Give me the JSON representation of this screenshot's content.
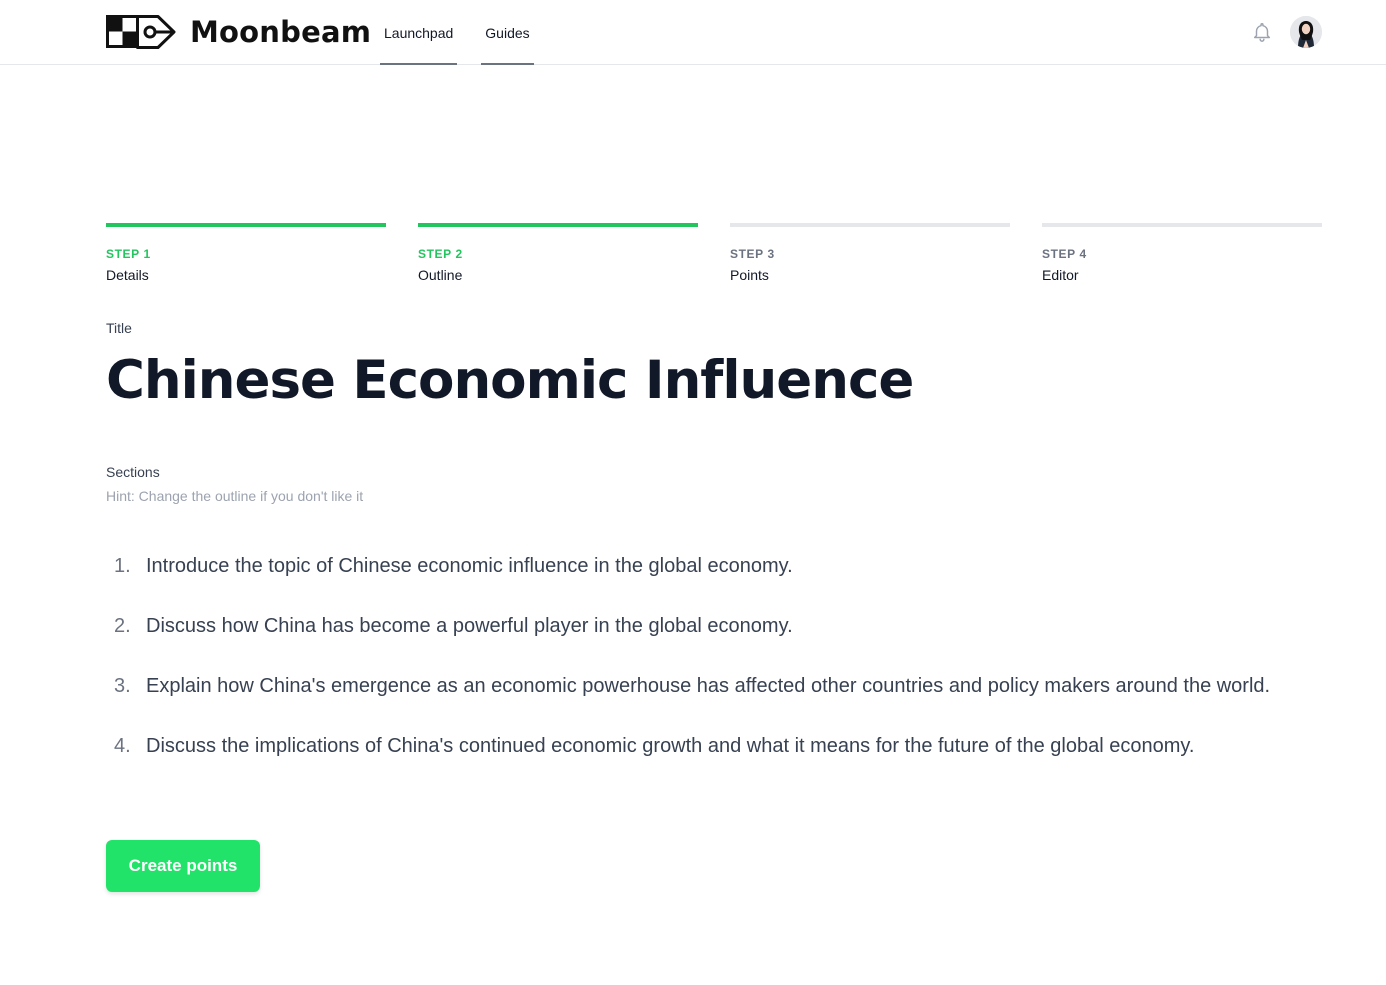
{
  "app": {
    "name": "Moonbeam",
    "brand_green": "#22e36a"
  },
  "nav": {
    "items": [
      {
        "label": "Launchpad"
      },
      {
        "label": "Guides"
      }
    ]
  },
  "header": {
    "notification_icon": "bell-icon",
    "avatar": "user-avatar"
  },
  "steps": [
    {
      "num": "STEP 1",
      "name": "Details",
      "completed": true
    },
    {
      "num": "STEP 2",
      "name": "Outline",
      "completed": true
    },
    {
      "num": "STEP 3",
      "name": "Points",
      "completed": false
    },
    {
      "num": "STEP 4",
      "name": "Editor",
      "completed": false
    }
  ],
  "form": {
    "title_label": "Title",
    "title_value": "Chinese Economic Influence",
    "sections_label": "Sections",
    "sections_hint": "Hint: Change the outline if you don't like it",
    "sections": [
      {
        "num": "1.",
        "text": "Introduce the topic of Chinese economic influence in the global economy."
      },
      {
        "num": "2.",
        "text": "Discuss how China has become a powerful player in the global economy."
      },
      {
        "num": "3.",
        "text": "Explain how China's emergence as an economic powerhouse has affected other countries and policy makers around the world."
      },
      {
        "num": "4.",
        "text": "Discuss the implications of China's continued economic growth and what it means for the future of the global economy."
      }
    ],
    "submit_label": "Create points"
  }
}
